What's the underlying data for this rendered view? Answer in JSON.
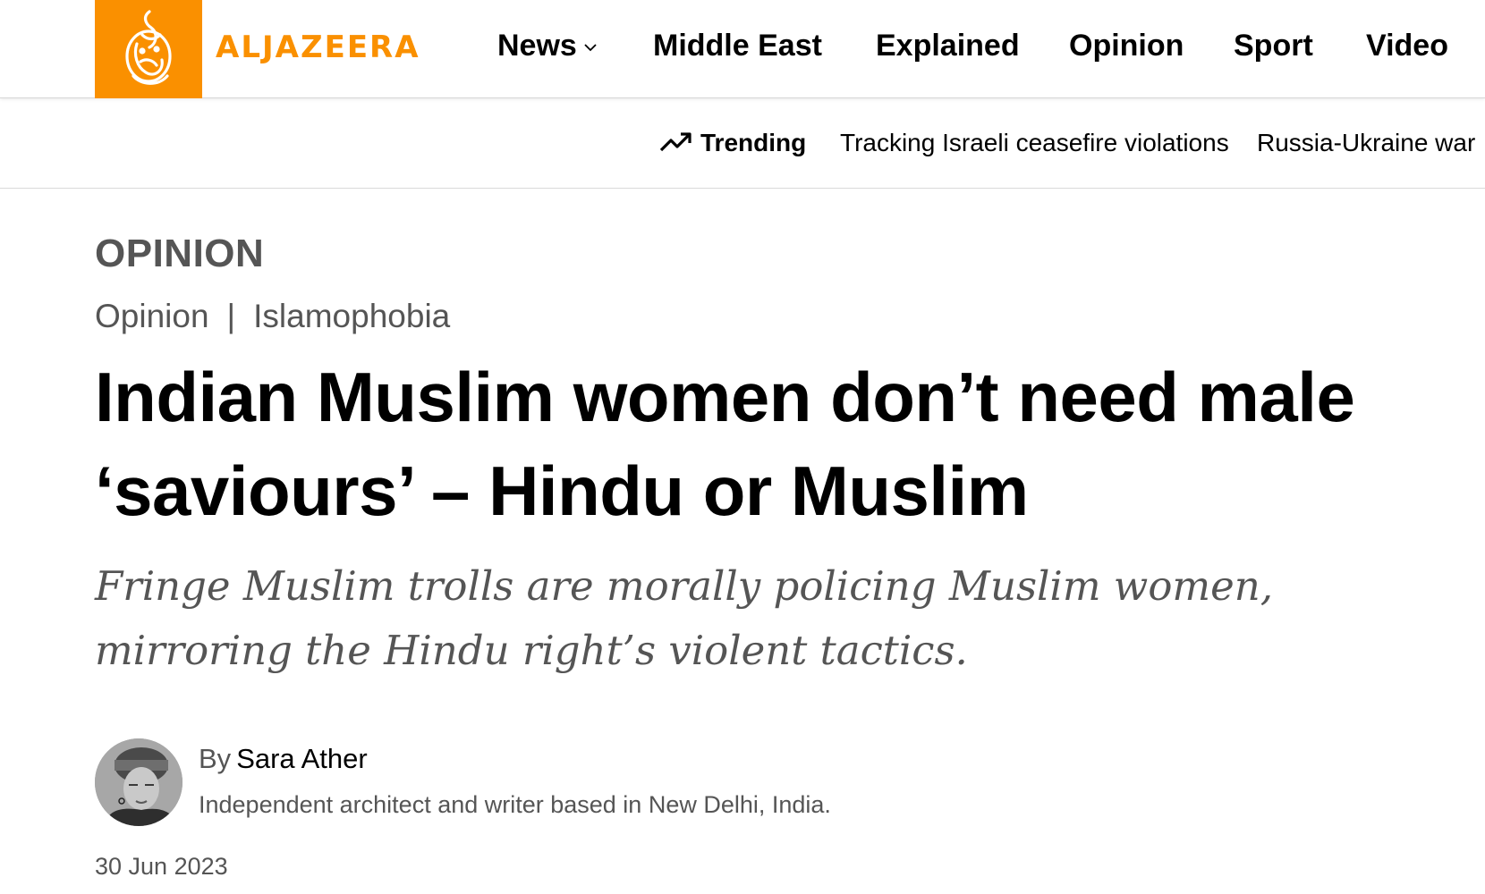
{
  "brand": {
    "name": "ALJAZEERA",
    "accent_color": "#fa9000"
  },
  "nav": {
    "items": [
      {
        "label": "News",
        "has_dropdown": true
      },
      {
        "label": "Middle East"
      },
      {
        "label": "Explained"
      },
      {
        "label": "Opinion"
      },
      {
        "label": "Sport"
      },
      {
        "label": "Video"
      }
    ]
  },
  "trending": {
    "label": "Trending",
    "icon": "trending-up-icon",
    "links": [
      "Tracking Israeli ceasefire violations",
      "Russia-Ukraine war"
    ]
  },
  "article": {
    "section": "OPINION",
    "breadcrumb": [
      "Opinion",
      "Islamophobia"
    ],
    "breadcrumb_separator": "|",
    "headline": "Indian Muslim women don’t need male ‘saviours’ – Hindu or Muslim",
    "subhead": "Fringe Muslim trolls are morally policing Muslim women, mirroring the Hindu right’s violent tactics.",
    "byline_prefix": "By",
    "author": "Sara Ather",
    "author_bio": "Independent architect and writer based in New Delhi, India.",
    "date": "30 Jun 2023"
  }
}
